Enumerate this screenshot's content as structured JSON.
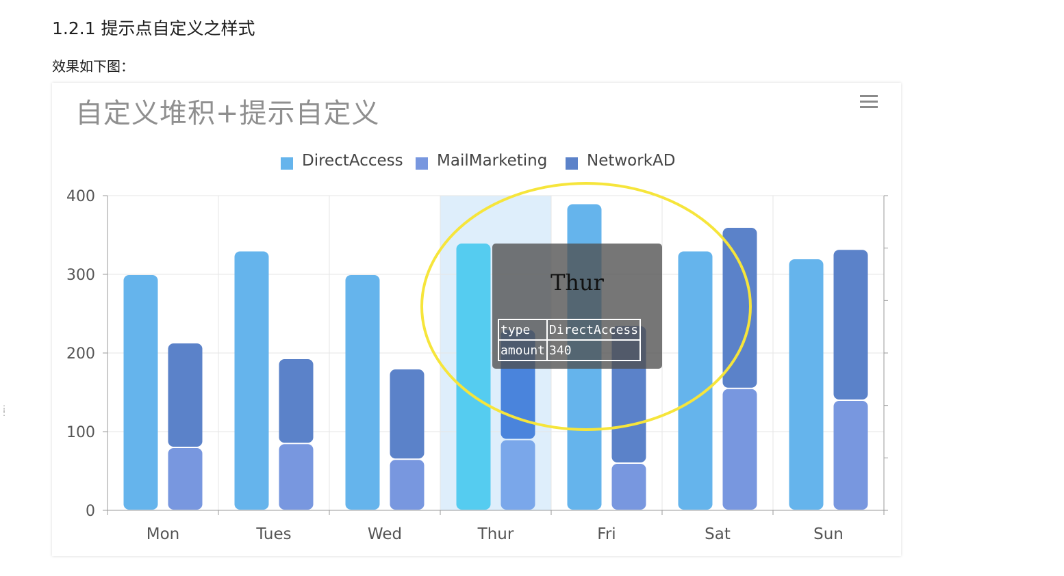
{
  "doc": {
    "heading": "1.2.1 提示点自定义之样式",
    "paragraph": "效果如下图："
  },
  "chart_data": {
    "type": "bar",
    "title": "自定义堆积+提示自定义",
    "categories": [
      "Mon",
      "Tues",
      "Wed",
      "Thur",
      "Fri",
      "Sat",
      "Sun"
    ],
    "ylim": [
      0,
      400
    ],
    "yticks": [
      0,
      100,
      200,
      300,
      400
    ],
    "grid": true,
    "legend_position": "top-center",
    "series": [
      {
        "name": "DirectAccess",
        "stack": "a",
        "color": "#65b4ec",
        "values": [
          300,
          330,
          300,
          340,
          390,
          330,
          320
        ]
      },
      {
        "name": "MailMarketing",
        "stack": "b",
        "color": "#7897df",
        "values": [
          80,
          85,
          65,
          90,
          60,
          155,
          140
        ]
      },
      {
        "name": "NetworkAD",
        "stack": "b",
        "color": "#5b82c9",
        "values": [
          133,
          108,
          115,
          140,
          175,
          205,
          192
        ]
      }
    ],
    "highlight_category": "Thur",
    "highlight_colors": {
      "DirectAccess": "#55ccf0",
      "MailMarketing": "#7aa7ea",
      "NetworkAD": "#4a84dc",
      "band": "#deeefb"
    }
  },
  "tooltip": {
    "title": "Thur",
    "rows": [
      {
        "key": "type",
        "value": "DirectAccess"
      },
      {
        "key": "amount",
        "value": "340"
      }
    ]
  },
  "annotation": {
    "color": "#f6e53b"
  },
  "menu": {
    "icon": "hamburger-menu-icon"
  }
}
